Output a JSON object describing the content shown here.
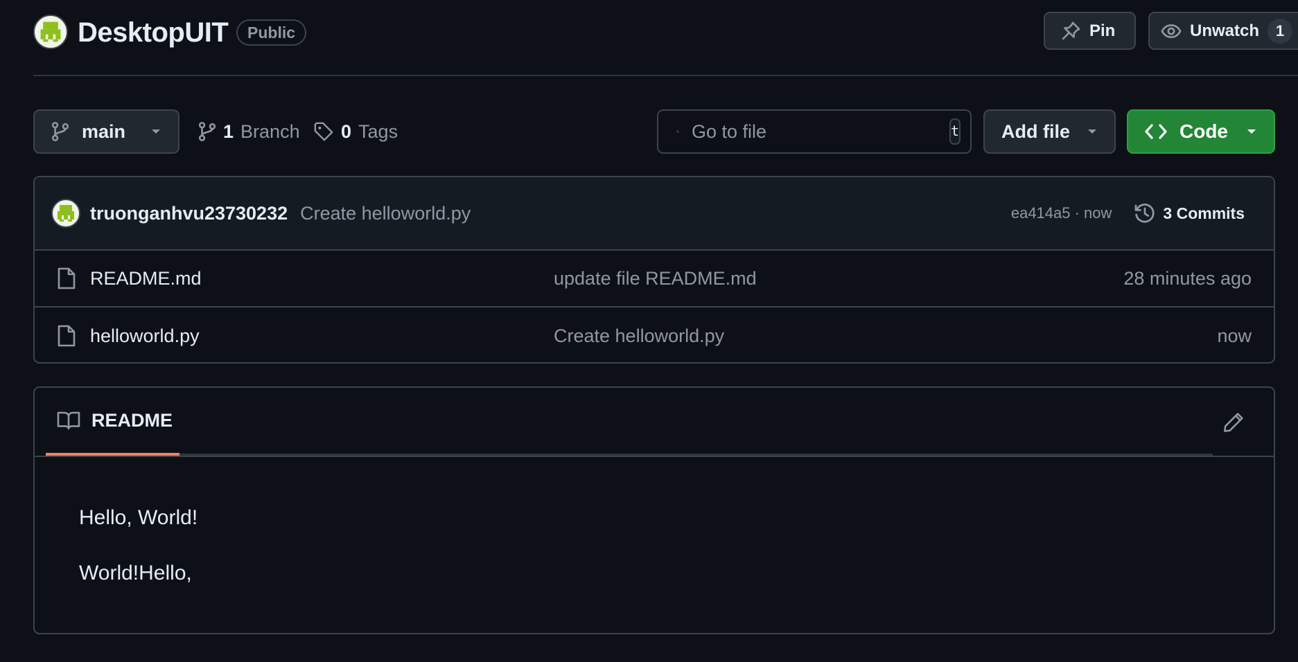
{
  "repo": {
    "name": "DesktopUIT",
    "visibility": "Public"
  },
  "actions": {
    "pin_label": "Pin",
    "watch_label": "Unwatch",
    "watch_count": "1"
  },
  "branch_bar": {
    "current_branch": "main",
    "branch_count": "1",
    "branch_label": "Branch",
    "tag_count": "0",
    "tag_label": "Tags",
    "search_placeholder": "Go to file",
    "search_shortcut": "t",
    "add_file_label": "Add file",
    "code_label": "Code"
  },
  "latest_commit": {
    "author": "truonganhvu23730232",
    "message": "Create helloworld.py",
    "meta": "ea414a5 · now",
    "commits_label": "3 Commits"
  },
  "files": [
    {
      "name": "README.md",
      "commit_message": "update file README.md",
      "time": "28 minutes ago"
    },
    {
      "name": "helloworld.py",
      "commit_message": "Create helloworld.py",
      "time": "now"
    }
  ],
  "readme": {
    "tab_label": "README",
    "lines": [
      "Hello, World!",
      "World!Hello,"
    ]
  },
  "colors": {
    "background": "#0d1117",
    "border": "#3d444d",
    "code_button": "#238636",
    "active_tab_underline": "#f78166"
  }
}
